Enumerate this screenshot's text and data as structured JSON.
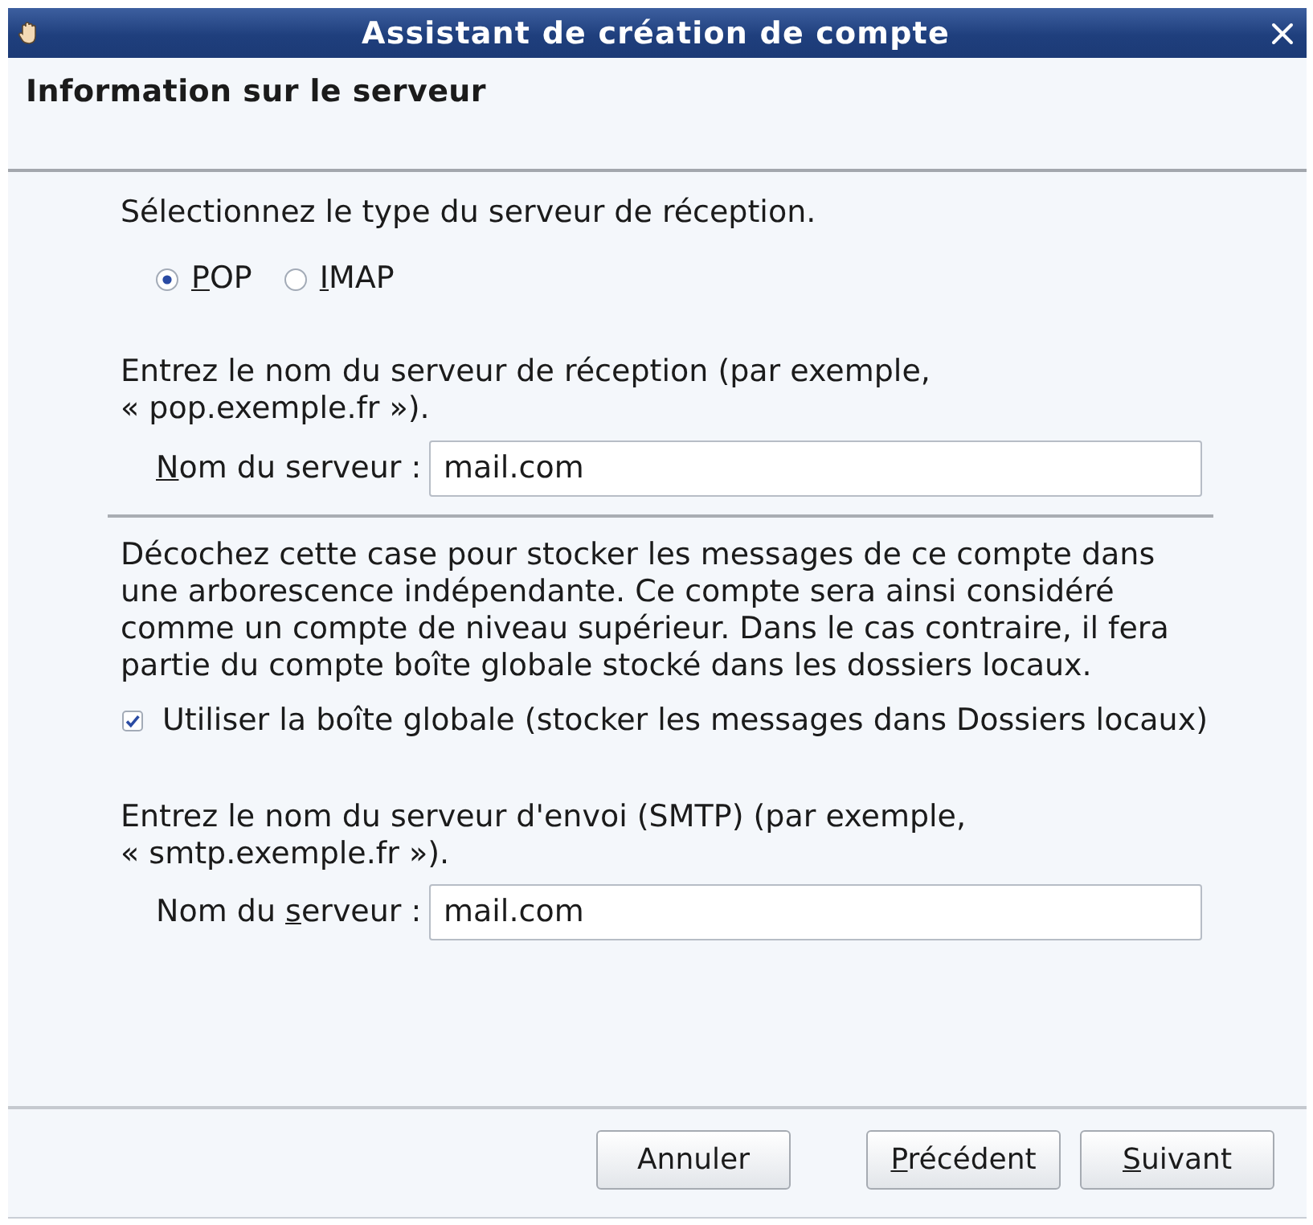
{
  "window": {
    "title": "Assistant de création de compte"
  },
  "header": {
    "title": "Information sur le serveur"
  },
  "incoming_type": {
    "prompt": "Sélectionnez le type du serveur de réception.",
    "options": [
      {
        "label_parts": [
          {
            "text": "P",
            "underlined": true
          },
          {
            "text": "OP",
            "underlined": false
          }
        ],
        "selected": true
      },
      {
        "label_parts": [
          {
            "text": "I",
            "underlined": true
          },
          {
            "text": "MAP",
            "underlined": false
          }
        ],
        "selected": false
      }
    ]
  },
  "incoming_server": {
    "prompt": "Entrez le nom du serveur de réception (par exemple,\n« pop.exemple.fr »).",
    "label_parts": [
      {
        "text": "N",
        "underlined": true
      },
      {
        "text": "om du serveur :",
        "underlined": false
      }
    ],
    "value": "mail.com"
  },
  "global_inbox": {
    "description": "Décochez cette case pour stocker les messages de ce compte dans\nune arborescence indépendante. Ce compte sera ainsi considéré\ncomme un compte de niveau supérieur. Dans le cas contraire, il fera\npartie du compte boîte globale stocké dans les dossiers locaux.",
    "label": "Utiliser la boîte globale (stocker les messages dans Dossiers locaux)",
    "checked": true
  },
  "outgoing_server": {
    "prompt": "Entrez le nom du serveur d'envoi (SMTP) (par exemple,\n« smtp.exemple.fr »).",
    "label_parts": [
      {
        "text": "Nom du ",
        "underlined": false
      },
      {
        "text": "s",
        "underlined": true
      },
      {
        "text": "erveur :",
        "underlined": false
      }
    ],
    "value": "mail.com"
  },
  "buttons": [
    {
      "label_parts": [
        {
          "text": "Annuler",
          "underlined": false
        }
      ]
    },
    {
      "label_parts": [
        {
          "text": "P",
          "underlined": true
        },
        {
          "text": "récédent",
          "underlined": false
        }
      ]
    },
    {
      "label_parts": [
        {
          "text": "S",
          "underlined": true
        },
        {
          "text": "uivant",
          "underlined": false
        }
      ]
    }
  ]
}
